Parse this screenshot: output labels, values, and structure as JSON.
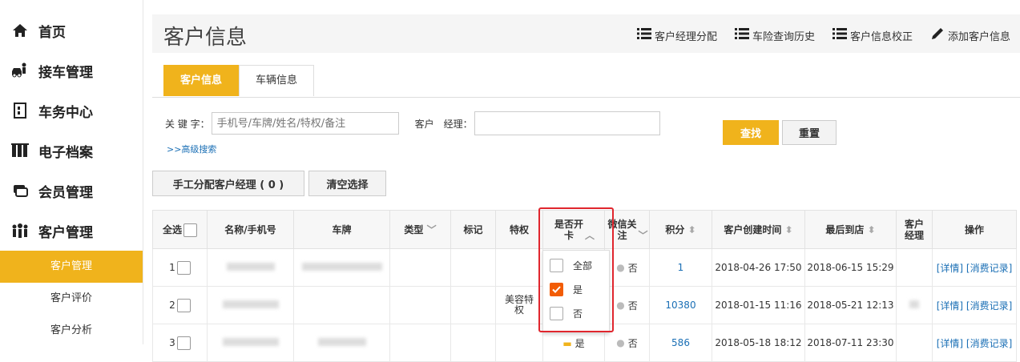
{
  "sidebar": {
    "items": [
      {
        "label": "首页",
        "icon": "home-icon"
      },
      {
        "label": "接车管理",
        "icon": "car-reception-icon"
      },
      {
        "label": "车务中心",
        "icon": "service-center-icon"
      },
      {
        "label": "电子档案",
        "icon": "archive-icon"
      },
      {
        "label": "会员管理",
        "icon": "member-card-icon"
      },
      {
        "label": "客户管理",
        "icon": "customers-icon"
      }
    ],
    "subitems": [
      "客户管理",
      "客户评价",
      "客户分析"
    ]
  },
  "header": {
    "title": "客户信息",
    "actions": [
      "客户经理分配",
      "车险查询历史",
      "客户信息校正",
      "添加客户信息"
    ]
  },
  "tabs": [
    "客户信息",
    "车辆信息"
  ],
  "filter": {
    "keyword_label": "关 键 字：",
    "keyword_placeholder": "手机号/车牌/姓名/特权/备注",
    "manager_label": "客户　经理：",
    "manager_value": "",
    "advanced": ">>高级搜索",
    "search_button": "查找",
    "reset_button": "重置"
  },
  "toolbar": {
    "assign_button": "手工分配客户经理 ( 0 )",
    "clear_button": "清空选择"
  },
  "table": {
    "headers": {
      "select_all": "全选",
      "name": "名称/手机号",
      "plate": "车牌",
      "type": "类型",
      "mark": "标记",
      "privilege": "特权",
      "card": "是否开卡",
      "wechat": "微信关注",
      "points": "积分",
      "created": "客户创建时间",
      "last_visit": "最后到店",
      "manager": "客户经理",
      "actions": "操作"
    },
    "rows": [
      {
        "index": "1",
        "privilege": "",
        "wechat": "否",
        "points": "1",
        "created": "2018-04-26 17:50",
        "last_visit": "2018-06-15 15:29",
        "detail": "[详情]",
        "records": "[消费记录]"
      },
      {
        "index": "2",
        "privilege": "美容特权",
        "wechat": "否",
        "points": "10380",
        "created": "2018-01-15 11:16",
        "last_visit": "2018-05-21 12:13",
        "detail": "[详情]",
        "records": "[消费记录]"
      },
      {
        "index": "3",
        "privilege": "",
        "card": "是",
        "wechat": "否",
        "points": "586",
        "created": "2018-05-18 18:12",
        "last_visit": "2018-07-11 23:30",
        "detail": "[详情]",
        "records": "[消费记录]"
      }
    ]
  },
  "card_filter": {
    "options": [
      {
        "label": "全部",
        "checked": false
      },
      {
        "label": "是",
        "checked": true
      },
      {
        "label": "否",
        "checked": false
      }
    ]
  },
  "colors": {
    "accent": "#f0b31c",
    "link": "#1a6fb5",
    "highlight": "#e0262e",
    "check": "#f25c05"
  }
}
